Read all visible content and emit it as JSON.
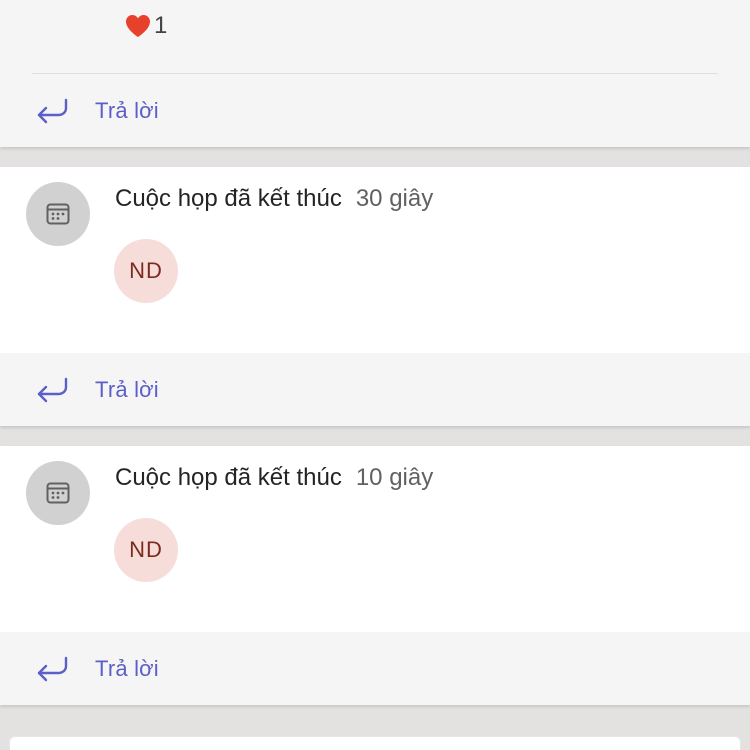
{
  "top_message": {
    "reaction": {
      "icon": "heart-icon",
      "count": "1",
      "color": "#e8412b"
    },
    "reply_label": "Trả lời"
  },
  "meetings": [
    {
      "icon": "calendar-icon",
      "title": "Cuộc họp đã kết thúc",
      "duration": "30 giây",
      "participant_initials": "ND",
      "reply_label": "Trả lời"
    },
    {
      "icon": "calendar-icon",
      "title": "Cuộc họp đã kết thúc",
      "duration": "10 giây",
      "participant_initials": "ND",
      "reply_label": "Trả lời"
    }
  ],
  "colors": {
    "accent": "#5b5fc7",
    "background": "#e3e2e1",
    "card": "#ffffff",
    "reply_bar": "#f5f5f5",
    "avatar_bg": "#f7ddd9",
    "avatar_text": "#7d2b1e"
  }
}
